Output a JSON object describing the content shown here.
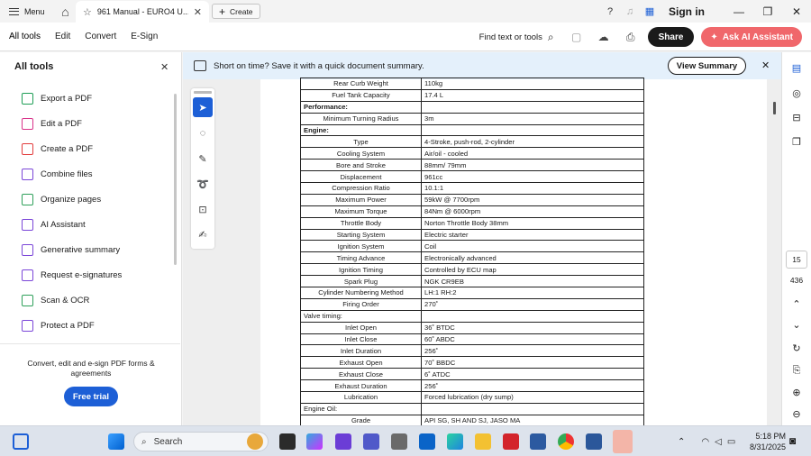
{
  "titlebar": {
    "menu_label": "Menu",
    "tab_title": "961 Manual - EURO4 U...",
    "create_label": "Create",
    "sign_in": "Sign in"
  },
  "menubar": {
    "items": [
      "All tools",
      "Edit",
      "Convert",
      "E-Sign"
    ],
    "find_label": "Find text or tools",
    "share_label": "Share",
    "ask_ai_label": "Ask AI Assistant"
  },
  "leftpanel": {
    "title": "All tools",
    "items": [
      {
        "label": "Export a PDF",
        "color": "#1e9e56"
      },
      {
        "label": "Edit a PDF",
        "color": "#d9338a"
      },
      {
        "label": "Create a PDF",
        "color": "#e23d3d"
      },
      {
        "label": "Combine files",
        "color": "#7b46d8"
      },
      {
        "label": "Organize pages",
        "color": "#2fa05a"
      },
      {
        "label": "AI Assistant",
        "color": "#7b46d8"
      },
      {
        "label": "Generative summary",
        "color": "#7b46d8"
      },
      {
        "label": "Request e-signatures",
        "color": "#7b46d8"
      },
      {
        "label": "Scan & OCR",
        "color": "#2fa05a"
      },
      {
        "label": "Protect a PDF",
        "color": "#7b46d8"
      }
    ],
    "promo_text": "Convert, edit and e-sign PDF forms & agreements",
    "trial_label": "Free trial"
  },
  "banner": {
    "text": "Short on time? Save it with a quick document summary.",
    "button": "View Summary"
  },
  "spec_rows": [
    {
      "k": "Rear Curb Weight",
      "v": "110kg"
    },
    {
      "k": "Fuel Tank Capacity",
      "v": "17.4 L"
    },
    {
      "section": "Performance:",
      "bold": true
    },
    {
      "k": "Minimum Turning Radius",
      "v": "3m"
    },
    {
      "section": "Engine:",
      "bold": true
    },
    {
      "k": "Type",
      "v": "4-Stroke, push-rod, 2-cylinder"
    },
    {
      "k": "Cooling System",
      "v": "Air/oil - cooled"
    },
    {
      "k": "Bore and Stroke",
      "v": "88mm/ 79mm"
    },
    {
      "k": "Displacement",
      "v": "961cc"
    },
    {
      "k": "Compression Ratio",
      "v": "10.1:1"
    },
    {
      "k": "Maximum Power",
      "v": "59kW @ 7700rpm"
    },
    {
      "k": "Maximum Torque",
      "v": "84Nm @ 6000rpm"
    },
    {
      "k": "Throttle Body",
      "v": "Norton Throttle Body 38mm"
    },
    {
      "k": "Starting System",
      "v": "Electric starter"
    },
    {
      "k": "Ignition System",
      "v": "Coil"
    },
    {
      "k": "Timing Advance",
      "v": "Electronically advanced"
    },
    {
      "k": "Ignition Timing",
      "v": "Controlled by ECU map"
    },
    {
      "k": "Spark Plug",
      "v": "NGK CR9EB"
    },
    {
      "k": "Cylinder Numbering Method",
      "v": "LH:1 RH:2"
    },
    {
      "k": "Firing Order",
      "v": "270˚"
    },
    {
      "section": "Valve timing:",
      "bold": false
    },
    {
      "k": "Inlet Open",
      "v": "36˚ BTDC"
    },
    {
      "k": "Inlet Close",
      "v": "60˚ ABDC"
    },
    {
      "k": "Inlet Duration",
      "v": "256˚"
    },
    {
      "k": "Exhaust Open",
      "v": "70˚ BBDC"
    },
    {
      "k": "Exhaust Close",
      "v": "6˚ ATDC"
    },
    {
      "k": "Exhaust Duration",
      "v": "256˚"
    },
    {
      "k": "Lubrication",
      "v": "Forced lubrication (dry sump)"
    },
    {
      "section": "Engine Oil:",
      "bold": false
    },
    {
      "k": "Grade",
      "v": "API SG, SH AND SJ, JASO MA"
    }
  ],
  "rightrail": {
    "current_page": "15",
    "total_pages": "436"
  },
  "taskbar": {
    "search_label": "Search",
    "time": "5:18 PM",
    "date": "8/31/2025"
  }
}
